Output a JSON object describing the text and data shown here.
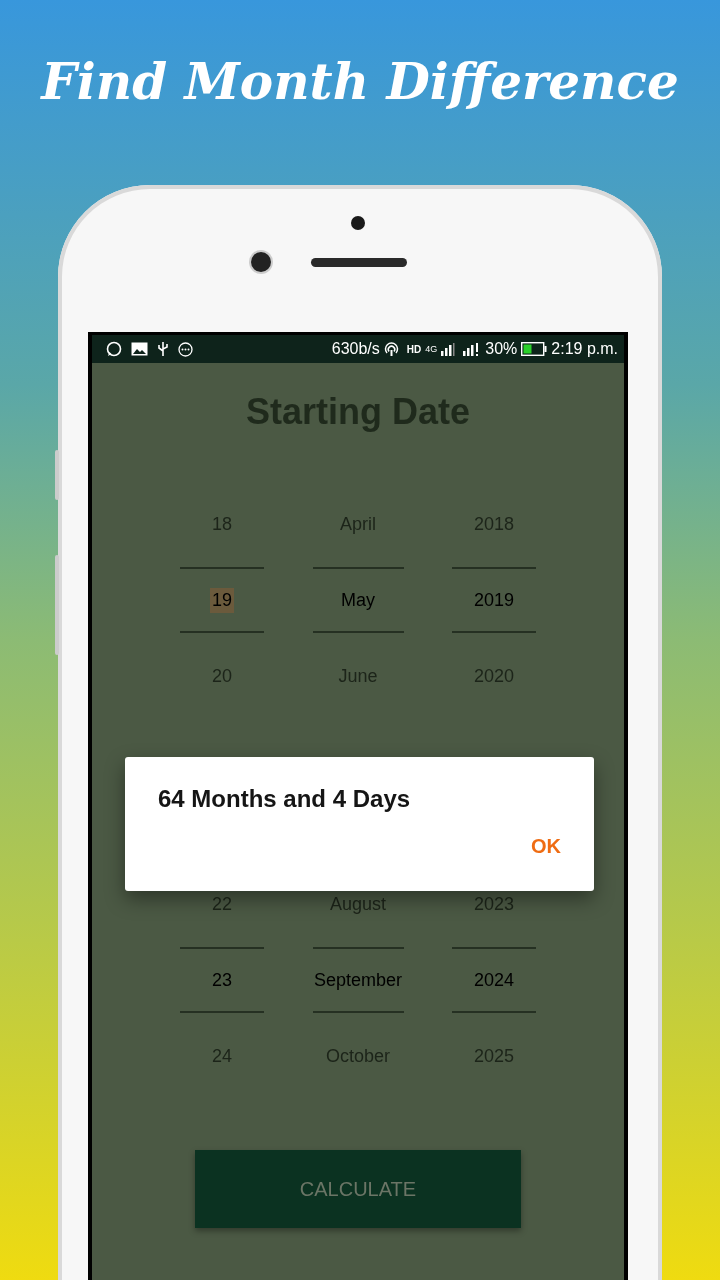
{
  "headline": "Find Month Difference",
  "status_bar": {
    "speed": "630b/s",
    "hd": "HD",
    "network": "4G",
    "battery": "30%",
    "time": "2:19 p.m."
  },
  "pickers": [
    {
      "title": "Starting Date",
      "columns": [
        {
          "focused": true,
          "items": [
            {
              "label": "18",
              "selected": false
            },
            {
              "label": "19",
              "selected": true
            },
            {
              "label": "20",
              "selected": false
            }
          ]
        },
        {
          "focused": false,
          "items": [
            {
              "label": "April",
              "selected": false
            },
            {
              "label": "May",
              "selected": true
            },
            {
              "label": "June",
              "selected": false
            }
          ]
        },
        {
          "focused": false,
          "items": [
            {
              "label": "2018",
              "selected": false
            },
            {
              "label": "2019",
              "selected": true
            },
            {
              "label": "2020",
              "selected": false
            }
          ]
        }
      ]
    },
    {
      "columns": [
        {
          "focused": false,
          "items": [
            {
              "label": "22",
              "selected": false
            },
            {
              "label": "23",
              "selected": true
            },
            {
              "label": "24",
              "selected": false
            }
          ]
        },
        {
          "focused": false,
          "items": [
            {
              "label": "August",
              "selected": false
            },
            {
              "label": "September",
              "selected": true
            },
            {
              "label": "October",
              "selected": false
            }
          ]
        },
        {
          "focused": false,
          "items": [
            {
              "label": "2023",
              "selected": false
            },
            {
              "label": "2024",
              "selected": true
            },
            {
              "label": "2025",
              "selected": false
            }
          ]
        }
      ]
    }
  ],
  "calculate_button": "CALCULATE",
  "dialog": {
    "message": "64 Months and 4 Days",
    "button": "OK"
  }
}
